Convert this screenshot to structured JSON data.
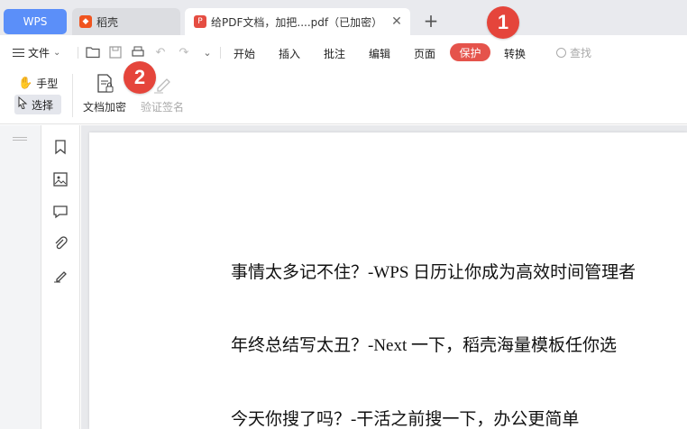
{
  "tabs": {
    "wps_label": "WPS",
    "daoke_label": "稻壳",
    "doc_label": "给PDF文档，加把....pdf（已加密）",
    "close_glyph": "✕",
    "add_glyph": "+"
  },
  "menu": {
    "file_label": "文件",
    "items": [
      "开始",
      "插入",
      "批注",
      "编辑",
      "页面",
      "保护",
      "转换"
    ],
    "active_item": "保护",
    "search_placeholder": "查找"
  },
  "ribbon": {
    "hand_label": "手型",
    "select_label": "选择",
    "encrypt_label": "文档加密",
    "verify_label": "验证签名"
  },
  "badges": [
    "1",
    "2"
  ],
  "document": {
    "lines": [
      "事情太多记不住？-WPS 日历让你成为高效时间管理者",
      "年终总结写太丑？-Next  一下，稻壳海量模板任你选",
      "今天你搜了吗？-干活之前搜一下，办公更简单"
    ]
  },
  "icons": [
    "hamburger-icon",
    "folder-open-icon",
    "save-icon",
    "print-icon",
    "undo-icon",
    "redo-icon",
    "more-icon",
    "search-icon",
    "hand-icon",
    "cursor-icon",
    "doc-encrypt-icon",
    "verify-signature-icon",
    "bookmark-icon",
    "image-icon",
    "comment-icon",
    "attachment-icon",
    "signature-icon"
  ],
  "colors": {
    "accent_red": "#e5453b",
    "wps_blue": "#5b8ff9"
  }
}
